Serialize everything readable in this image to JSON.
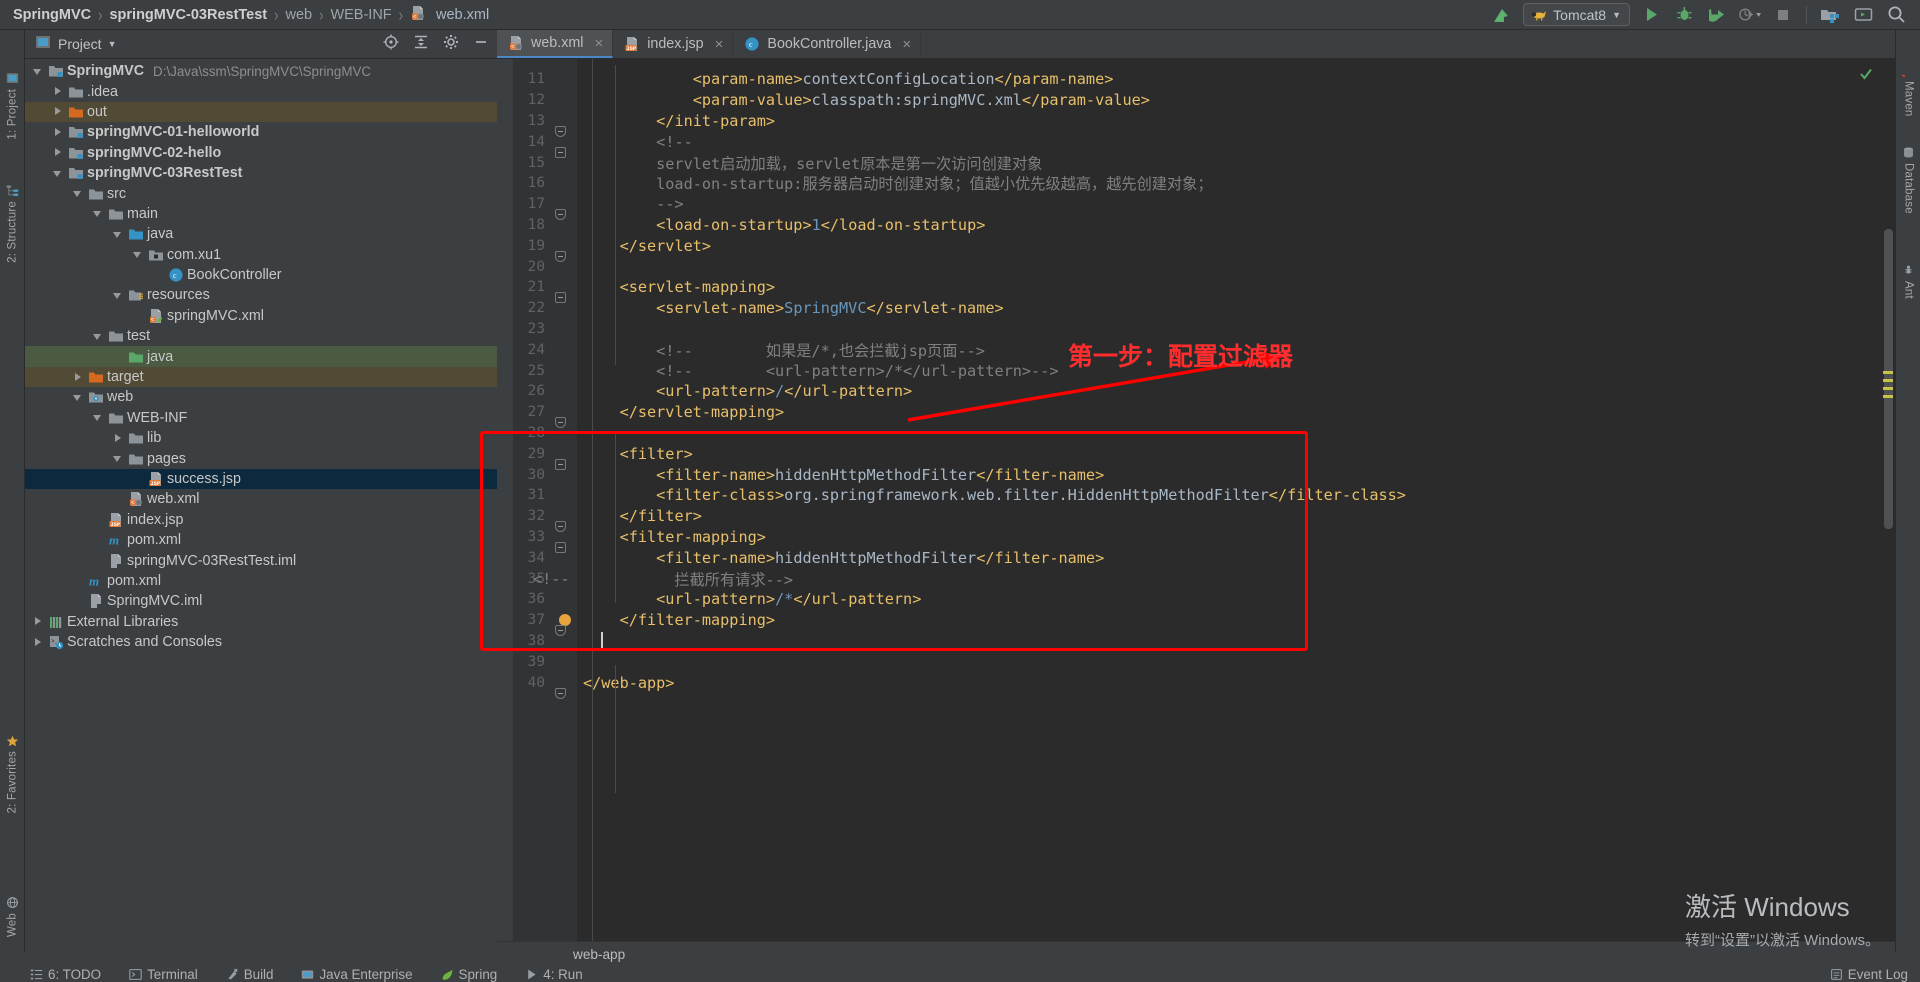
{
  "window": {
    "breadcrumb": [
      {
        "label": "SpringMVC",
        "style": "bold"
      },
      {
        "label": "springMVC-03RestTest",
        "style": "bold"
      },
      {
        "label": "web",
        "style": "dim"
      },
      {
        "label": "WEB-INF",
        "style": "dim"
      },
      {
        "label": "web.xml",
        "style": "file",
        "icon": "xml-file-icon"
      }
    ],
    "separator": "›"
  },
  "toolbar": {
    "update_label": "update-application-icon",
    "run_config": {
      "name": "Tomcat8",
      "icon": "tomcat-cat-icon",
      "chevron": "▼"
    },
    "buttons": [
      {
        "name": "run-button",
        "icon": "play-icon"
      },
      {
        "name": "debug-button",
        "icon": "bug-icon"
      },
      {
        "name": "run-with-coverage-button",
        "icon": "coverage-icon"
      },
      {
        "name": "profile-button",
        "icon": "profile-icon"
      },
      {
        "name": "stop-button",
        "icon": "stop-icon"
      },
      {
        "name": "project-structure-button",
        "icon": "project-structure-icon"
      },
      {
        "name": "terminal-button",
        "icon": "terminal-icon"
      },
      {
        "name": "search-everywhere-button",
        "icon": "search-icon"
      }
    ]
  },
  "left_rail": [
    {
      "label": "1: Project",
      "icon": "project-icon"
    },
    {
      "label": "2: Structure",
      "icon": "structure-icon"
    },
    {
      "label": "2: Favorites",
      "icon": "favorites-icon"
    },
    {
      "label": "Web",
      "icon": "web-icon"
    }
  ],
  "right_rail": [
    {
      "label": "Maven",
      "icon": "maven-icon"
    },
    {
      "label": "Database",
      "icon": "database-icon"
    },
    {
      "label": "Ant",
      "icon": "ant-icon"
    }
  ],
  "project_panel": {
    "title": "Project",
    "title_chevron": "▼",
    "actions": [
      {
        "name": "select-opened-file-button",
        "icon": "target-icon"
      },
      {
        "name": "collapse-all-button",
        "icon": "collapse-icon"
      },
      {
        "name": "settings-button",
        "icon": "gear-icon"
      },
      {
        "name": "hide-button",
        "icon": "minimize-icon"
      }
    ],
    "tree": [
      {
        "label": "SpringMVC",
        "path": "D:\\Java\\ssm\\SpringMVC\\SpringMVC",
        "depth": 0,
        "arrow": "down",
        "icon": "module-icon",
        "bold": true,
        "select": ""
      },
      {
        "label": ".idea",
        "depth": 1,
        "arrow": "right",
        "icon": "folder-icon",
        "select": ""
      },
      {
        "label": "out",
        "depth": 1,
        "arrow": "right",
        "icon": "folder-orange-icon",
        "select": "brown"
      },
      {
        "label": "springMVC-01-helloworld",
        "depth": 1,
        "arrow": "right",
        "icon": "module-icon",
        "bold": true,
        "select": ""
      },
      {
        "label": "springMVC-02-hello",
        "depth": 1,
        "arrow": "right",
        "icon": "module-icon",
        "bold": true,
        "select": ""
      },
      {
        "label": "springMVC-03RestTest",
        "depth": 1,
        "arrow": "down",
        "icon": "module-icon",
        "bold": true,
        "select": ""
      },
      {
        "label": "src",
        "depth": 2,
        "arrow": "down",
        "icon": "folder-icon",
        "select": ""
      },
      {
        "label": "main",
        "depth": 3,
        "arrow": "down",
        "icon": "folder-icon",
        "select": ""
      },
      {
        "label": "java",
        "depth": 4,
        "arrow": "down",
        "icon": "folder-source-icon",
        "select": ""
      },
      {
        "label": "com.xu1",
        "depth": 5,
        "arrow": "down",
        "icon": "package-icon",
        "select": ""
      },
      {
        "label": "BookController",
        "depth": 6,
        "arrow": "none",
        "icon": "java-class-icon",
        "select": ""
      },
      {
        "label": "resources",
        "depth": 4,
        "arrow": "down",
        "icon": "folder-resources-icon",
        "select": ""
      },
      {
        "label": "springMVC.xml",
        "depth": 5,
        "arrow": "none",
        "icon": "spring-xml-icon",
        "select": ""
      },
      {
        "label": "test",
        "depth": 3,
        "arrow": "down",
        "icon": "folder-icon",
        "select": ""
      },
      {
        "label": "java",
        "depth": 4,
        "arrow": "none",
        "icon": "folder-test-icon",
        "select": "green"
      },
      {
        "label": "target",
        "depth": 2,
        "arrow": "right",
        "icon": "folder-orange-icon",
        "select": "brown"
      },
      {
        "label": "web",
        "depth": 2,
        "arrow": "down",
        "icon": "folder-web-icon",
        "select": ""
      },
      {
        "label": "WEB-INF",
        "depth": 3,
        "arrow": "down",
        "icon": "folder-icon",
        "select": ""
      },
      {
        "label": "lib",
        "depth": 4,
        "arrow": "right",
        "icon": "folder-icon",
        "select": ""
      },
      {
        "label": "pages",
        "depth": 4,
        "arrow": "down",
        "icon": "folder-icon",
        "select": ""
      },
      {
        "label": "success.jsp",
        "depth": 5,
        "arrow": "none",
        "icon": "jsp-file-icon",
        "select": "blue"
      },
      {
        "label": "web.xml",
        "depth": 4,
        "arrow": "none",
        "icon": "xml-file-icon",
        "select": ""
      },
      {
        "label": "index.jsp",
        "depth": 3,
        "arrow": "none",
        "icon": "jsp-file-icon",
        "select": ""
      },
      {
        "label": "pom.xml",
        "depth": 3,
        "arrow": "none",
        "icon": "maven-pom-icon",
        "select": ""
      },
      {
        "label": "springMVC-03RestTest.iml",
        "depth": 3,
        "arrow": "none",
        "icon": "iml-file-icon",
        "select": ""
      },
      {
        "label": "pom.xml",
        "depth": 2,
        "arrow": "none",
        "icon": "maven-pom-icon",
        "select": ""
      },
      {
        "label": "SpringMVC.iml",
        "depth": 2,
        "arrow": "none",
        "icon": "iml-file-icon",
        "select": ""
      },
      {
        "label": "External Libraries",
        "depth": 0,
        "arrow": "right",
        "icon": "libraries-icon",
        "select": ""
      },
      {
        "label": "Scratches and Consoles",
        "depth": 0,
        "arrow": "right",
        "icon": "scratches-icon",
        "select": ""
      }
    ]
  },
  "editor_tabs": [
    {
      "label": "web.xml",
      "icon": "xml-file-icon",
      "active": true,
      "close": "×"
    },
    {
      "label": "index.jsp",
      "icon": "jsp-file-icon",
      "active": false,
      "close": "×"
    },
    {
      "label": "BookController.java",
      "icon": "java-class-icon",
      "active": false,
      "close": "×"
    }
  ],
  "editor": {
    "breadcrumb": "web-app",
    "lines": [
      {
        "n": 11,
        "segs": [
          {
            "t": "            ",
            "c": "txt"
          },
          {
            "t": "<param-name>",
            "c": "tag"
          },
          {
            "t": "contextConfigLocation",
            "c": "txt"
          },
          {
            "t": "</param-name>",
            "c": "tag"
          }
        ],
        "fold": ""
      },
      {
        "n": 12,
        "segs": [
          {
            "t": "            ",
            "c": "txt"
          },
          {
            "t": "<param-value>",
            "c": "tag"
          },
          {
            "t": "classpath:springMVC.xml",
            "c": "txt"
          },
          {
            "t": "</param-value>",
            "c": "tag"
          }
        ],
        "fold": ""
      },
      {
        "n": 13,
        "segs": [
          {
            "t": "        ",
            "c": "txt"
          },
          {
            "t": "</init-param>",
            "c": "tag"
          }
        ],
        "fold": "end"
      },
      {
        "n": 14,
        "segs": [
          {
            "t": "        ",
            "c": "txt"
          },
          {
            "t": "<!--",
            "c": "cmt"
          }
        ],
        "fold": "start"
      },
      {
        "n": 15,
        "segs": [
          {
            "t": "        servlet启动加载，servlet原本是第一次访问创建对象",
            "c": "cmt"
          }
        ],
        "fold": ""
      },
      {
        "n": 16,
        "segs": [
          {
            "t": "        load-on-startup:服务器启动时创建对象；值越小优先级越高，越先创建对象；",
            "c": "cmt"
          }
        ],
        "fold": ""
      },
      {
        "n": 17,
        "segs": [
          {
            "t": "        -->",
            "c": "cmt"
          }
        ],
        "fold": "end"
      },
      {
        "n": 18,
        "segs": [
          {
            "t": "        ",
            "c": "txt"
          },
          {
            "t": "<load-on-startup>",
            "c": "tag"
          },
          {
            "t": "1",
            "c": "num"
          },
          {
            "t": "</load-on-startup>",
            "c": "tag"
          }
        ],
        "fold": ""
      },
      {
        "n": 19,
        "segs": [
          {
            "t": "    ",
            "c": "txt"
          },
          {
            "t": "</servlet>",
            "c": "tag"
          }
        ],
        "fold": "end"
      },
      {
        "n": 20,
        "segs": [],
        "fold": ""
      },
      {
        "n": 21,
        "segs": [
          {
            "t": "    ",
            "c": "txt"
          },
          {
            "t": "<servlet-mapping>",
            "c": "tag"
          }
        ],
        "fold": "start"
      },
      {
        "n": 22,
        "segs": [
          {
            "t": "        ",
            "c": "txt"
          },
          {
            "t": "<servlet-name>",
            "c": "tag"
          },
          {
            "t": "SpringMVC",
            "c": "num"
          },
          {
            "t": "</servlet-name>",
            "c": "tag"
          }
        ],
        "fold": ""
      },
      {
        "n": 23,
        "segs": [],
        "fold": ""
      },
      {
        "n": 24,
        "segs": [
          {
            "t": "        <!--        如果是/*,也会拦截jsp页面-->",
            "c": "cmt"
          }
        ],
        "fold": ""
      },
      {
        "n": 25,
        "segs": [
          {
            "t": "        <!--        <url-pattern>/*</url-pattern>-->",
            "c": "cmt"
          }
        ],
        "fold": ""
      },
      {
        "n": 26,
        "segs": [
          {
            "t": "        ",
            "c": "txt"
          },
          {
            "t": "<url-pattern>",
            "c": "tag"
          },
          {
            "t": "/",
            "c": "num"
          },
          {
            "t": "</url-pattern>",
            "c": "tag"
          }
        ],
        "fold": ""
      },
      {
        "n": 27,
        "segs": [
          {
            "t": "    ",
            "c": "txt"
          },
          {
            "t": "</servlet-mapping>",
            "c": "tag"
          }
        ],
        "fold": "end"
      },
      {
        "n": 28,
        "segs": [],
        "fold": ""
      },
      {
        "n": 29,
        "segs": [
          {
            "t": "    ",
            "c": "txt"
          },
          {
            "t": "<filter>",
            "c": "tag"
          }
        ],
        "fold": "start"
      },
      {
        "n": 30,
        "segs": [
          {
            "t": "        ",
            "c": "txt"
          },
          {
            "t": "<filter-name>",
            "c": "tag"
          },
          {
            "t": "hiddenHttpMethodFilter",
            "c": "txt"
          },
          {
            "t": "</filter-name>",
            "c": "tag"
          }
        ],
        "fold": ""
      },
      {
        "n": 31,
        "segs": [
          {
            "t": "        ",
            "c": "txt"
          },
          {
            "t": "<filter-class>",
            "c": "tag"
          },
          {
            "t": "org.springframework.web.filter.HiddenHttpMethodFilter",
            "c": "txt"
          },
          {
            "t": "</filter-class>",
            "c": "tag"
          }
        ],
        "fold": ""
      },
      {
        "n": 32,
        "segs": [
          {
            "t": "    ",
            "c": "txt"
          },
          {
            "t": "</filter>",
            "c": "tag"
          }
        ],
        "fold": "end"
      },
      {
        "n": 33,
        "segs": [
          {
            "t": "    ",
            "c": "txt"
          },
          {
            "t": "<filter-mapping>",
            "c": "tag"
          }
        ],
        "fold": "start"
      },
      {
        "n": 34,
        "segs": [
          {
            "t": "        ",
            "c": "txt"
          },
          {
            "t": "<filter-name>",
            "c": "tag"
          },
          {
            "t": "hiddenHttpMethodFilter",
            "c": "txt"
          },
          {
            "t": "</filter-name>",
            "c": "tag"
          }
        ],
        "fold": ""
      },
      {
        "n": 35,
        "segs": [
          {
            "t": "          拦截所有请求-->",
            "c": "cmt"
          }
        ],
        "fold": "",
        "prefix_comment": "<!--"
      },
      {
        "n": 36,
        "segs": [
          {
            "t": "        ",
            "c": "txt"
          },
          {
            "t": "<url-pattern>",
            "c": "tag"
          },
          {
            "t": "/*",
            "c": "num"
          },
          {
            "t": "</url-pattern>",
            "c": "tag"
          }
        ],
        "fold": ""
      },
      {
        "n": 37,
        "segs": [
          {
            "t": "    ",
            "c": "txt"
          },
          {
            "t": "</filter-mapping>",
            "c": "tag"
          }
        ],
        "fold": "end",
        "bulb": true
      },
      {
        "n": 38,
        "segs": [],
        "fold": "",
        "caret": true
      },
      {
        "n": 39,
        "segs": [],
        "fold": ""
      },
      {
        "n": 40,
        "segs": [
          {
            "t": "",
            "c": "txt"
          },
          {
            "t": "</web-app>",
            "c": "tag"
          }
        ],
        "fold": "end"
      }
    ]
  },
  "annotation": {
    "text": "第一步：配置过滤器",
    "color": "#ff2d2d"
  },
  "status_bar": {
    "left_items": [
      {
        "label": "6: TODO",
        "icon": "todo-icon"
      },
      {
        "label": "Terminal",
        "icon": "terminal-icon"
      },
      {
        "label": "Build",
        "icon": "build-icon"
      },
      {
        "label": "Java Enterprise",
        "icon": "java-enterprise-icon"
      },
      {
        "label": "Spring",
        "icon": "spring-icon"
      },
      {
        "label": "4: Run",
        "icon": "run-icon"
      }
    ],
    "right_items": [
      {
        "label": "Event Log",
        "icon": "event-log-icon"
      }
    ]
  },
  "watermark": {
    "line1": "激活 Windows",
    "line2": "转到“设置”以激活 Windows。"
  }
}
